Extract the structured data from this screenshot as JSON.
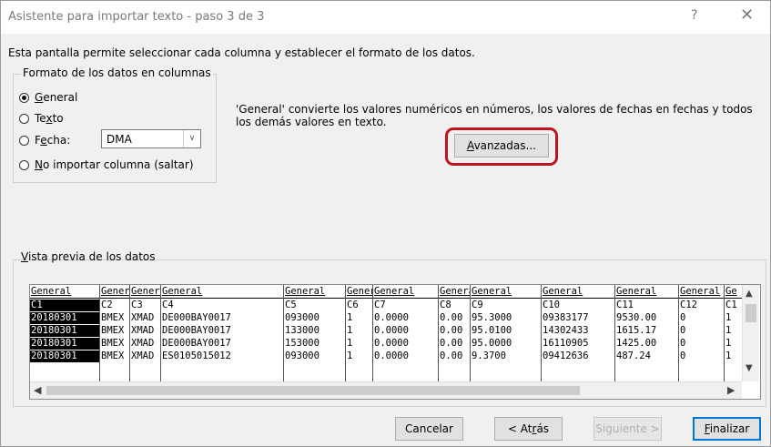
{
  "window": {
    "title": "Asistente para importar texto - paso 3 de 3",
    "help": "?",
    "close": "✕"
  },
  "description": "Esta pantalla permite seleccionar cada columna y establecer el formato de los datos.",
  "format_group": {
    "legend": "Formato de los datos en columnas",
    "options": [
      {
        "pre": "",
        "key": "G",
        "rest": "eneral",
        "selected": true
      },
      {
        "pre": "Te",
        "key": "x",
        "rest": "to",
        "selected": false
      },
      {
        "pre": "F",
        "key": "e",
        "rest": "cha:",
        "selected": false
      },
      {
        "pre": "",
        "key": "N",
        "rest": "o importar columna (saltar)",
        "selected": false
      }
    ],
    "date_format": "DMA"
  },
  "info_text": "'General' convierte los valores numéricos en números, los valores de fechas en fechas y todos los demás valores en texto.",
  "advanced_button": {
    "key": "A",
    "rest": "vanzadas..."
  },
  "preview": {
    "label_pre": "",
    "label_key": "V",
    "label_rest": "ista previa de los datos",
    "headers": [
      "General",
      "General",
      "General",
      "General",
      "General",
      "General",
      "General",
      "General",
      "General",
      "General",
      "General",
      "General",
      "Ge"
    ],
    "rows": [
      [
        "C1",
        "C2",
        "C3",
        "C4",
        "C5",
        "C6",
        "C7",
        "C8",
        "C9",
        "C10",
        "C11",
        "C12",
        "C1"
      ],
      [
        "20180301",
        "BMEX",
        "XMAD",
        "DE000BAY0017",
        "093000",
        "1",
        "0.0000",
        "0.00",
        "95.3000",
        "09383177",
        "9530.00",
        "0",
        "1"
      ],
      [
        "20180301",
        "BMEX",
        "XMAD",
        "DE000BAY0017",
        "133000",
        "1",
        "0.0000",
        "0.00",
        "95.0100",
        "14302433",
        "1615.17",
        "0",
        "1"
      ],
      [
        "20180301",
        "BMEX",
        "XMAD",
        "DE000BAY0017",
        "153000",
        "1",
        "0.0000",
        "0.00",
        "95.0000",
        "16110905",
        "1425.00",
        "0",
        "1"
      ],
      [
        "20180301",
        "BMEX",
        "XMAD",
        "ES0105015012",
        "093000",
        "1",
        "0.0000",
        "0.00",
        "9.3700",
        "09412636",
        "487.24",
        "0",
        "1"
      ]
    ]
  },
  "buttons": {
    "cancel": "Cancelar",
    "back_pre": "< At",
    "back_key": "r",
    "back_rest": "ás",
    "next": "Siguiente >",
    "finish_key": "F",
    "finish_rest": "inalizar"
  },
  "scroll_icons": {
    "up": "▲",
    "down": "▼",
    "left": "◀",
    "right": "▶"
  }
}
